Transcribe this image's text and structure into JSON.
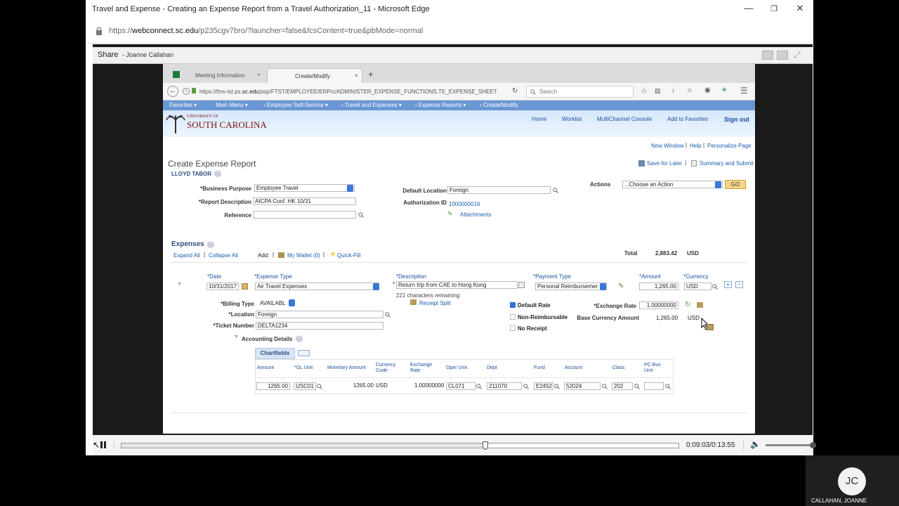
{
  "window": {
    "title": "Travel and Expense - Creating an Expense Report from a Travel Authorization_11 - Microsoft Edge"
  },
  "address": {
    "prefix": "https://",
    "domain": "webconnect.sc.edu",
    "path": "/p235cgv7bro/?launcher=false&fcsContent=true&pbMode=normal"
  },
  "share": {
    "label": "Share",
    "name": "- Joanne Callahan"
  },
  "inner": {
    "tabs": [
      "Meeting Information",
      "Create/Modify"
    ],
    "url_prefix": "https://fms-tst.ps.",
    "url_domain": "sc.edu",
    "url_path": "/psp/FTST/EMPLOYEE/ERP/c/ADMINISTER_EXPENSE_FUNCTIONS.TE_EXPENSE_SHEET",
    "search_placeholder": "Search",
    "breadcrumbs": [
      "Favorites ▾",
      "Main Menu ▾",
      "›  Employee Self-Service ▾",
      "›  Travel and Expenses ▾",
      "›  Expense Reports ▾",
      "›  Create/Modify"
    ],
    "header_links": [
      "Home",
      "Worklist",
      "MultiChannel Console",
      "Add to Favorites",
      "Sign out"
    ],
    "logo_top": "UNIVERSITY OF",
    "logo_main": "SOUTH CAROLINA"
  },
  "page": {
    "top_links": [
      "New Window",
      "Help",
      "Personalize Page"
    ],
    "title": "Create Expense Report",
    "employee": "LLOYD TABOR",
    "save_later": "Save for Later",
    "summary_submit": "Summary and Submit",
    "actions_label": "Actions",
    "actions_value": "...Choose an Action",
    "go": "GO",
    "business_purpose_label": "*Business Purpose",
    "business_purpose": "Employee Travel",
    "report_desc_label": "*Report Description",
    "report_desc": "AICPA Conf. HK 10/31",
    "reference_label": "Reference",
    "default_location_label": "Default Location",
    "default_location": "Foreign",
    "auth_id_label": "Authorization ID",
    "auth_id": "1000000016",
    "attachments": "Attachments",
    "expenses_title": "Expenses",
    "expand_all": "Expand All",
    "collapse_all": "Collapse All",
    "add_label": "Add:",
    "my_wallet": "My Wallet (0)",
    "quick_fill": "Quick-Fill",
    "total_label": "Total",
    "total_value": "2,883.42",
    "total_currency": "USD"
  },
  "line": {
    "headers": {
      "date": "*Date",
      "type": "*Expense Type",
      "desc": "*Description",
      "payment": "*Payment Type",
      "amount": "*Amount",
      "currency": "*Currency"
    },
    "date": "10/31/2017",
    "type": "Air Travel Expenses",
    "desc": "Return trip from CAE to Hong Kong",
    "chars_remaining": "221 characters remaining",
    "receipt_split": "Receipt Split",
    "payment": "Personal Reimbursemer",
    "amount": "1,265.00",
    "currency": "USD",
    "billing_type_label": "*Billing Type",
    "billing_type": "AVAILABL",
    "location_label": "*Location",
    "location": "Foreign",
    "ticket_label": "*Ticket Number",
    "ticket": "DELTA1234",
    "default_rate": "Default Rate",
    "non_reimbursable": "Non-Reimbursable",
    "no_receipt": "No Receipt",
    "exchange_rate_label": "*Exchange Rate",
    "exchange_rate": "1.00000000",
    "base_amount_label": "Base Currency Amount",
    "base_amount": "1,265.00",
    "base_currency": "USD",
    "accounting_details": "Accounting Details",
    "chartfields_tab": "Chartfields"
  },
  "grid": {
    "headers": [
      "Amount",
      "*GL Unit",
      "Monetary Amount",
      "Currency Code",
      "Exchange Rate",
      "Oper Unit",
      "Dept",
      "Fund",
      "Account",
      "Class",
      "PC Bus Unit"
    ],
    "row": {
      "amount": "1265.00",
      "gl_unit": "USC01",
      "monetary": "1265.00",
      "currency": "USD",
      "rate": "1.00000000",
      "oper_unit": "CL071",
      "dept": "211070",
      "fund": "E2452",
      "account": "52024",
      "class": "202",
      "pc_bus": ""
    }
  },
  "playback": {
    "time": "0:09:03/0:13:55",
    "progress": 0.653
  },
  "participant": {
    "initials": "JC",
    "name": "CALLAHAN, JOANNE"
  }
}
